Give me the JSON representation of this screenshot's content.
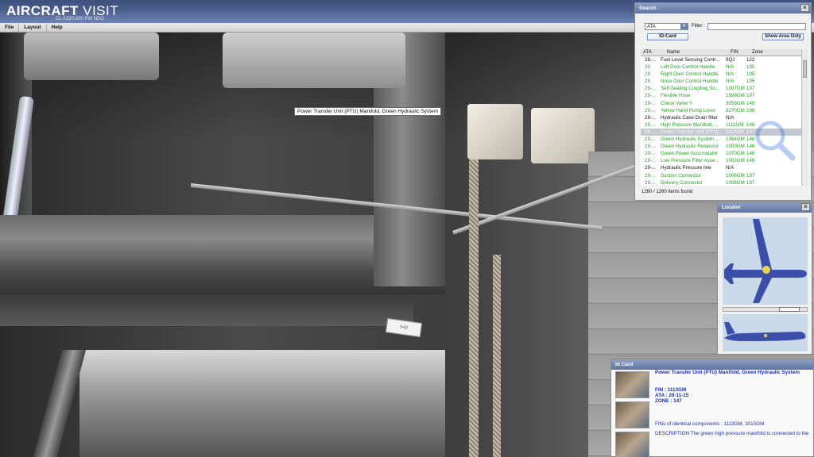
{
  "app": {
    "brand_bold": "AIRCRAFT",
    "brand_light": " VISIT",
    "subtitle": "CL A320-200 PW NEO"
  },
  "menu": [
    "File",
    "Layout",
    "Help"
  ],
  "tooltip": "Power Transfer Unit (PTU) Manifold, Green Hydraulic System",
  "tag_label": "3-02",
  "search": {
    "title": "Search",
    "category": "ATA",
    "filter_label": "Filter :",
    "filter_value": "",
    "id_card_button": "ID-Card",
    "show_area_button": "Show Area Only",
    "columns": [
      "ATA",
      "Name",
      "FIN",
      "Zone"
    ],
    "rows": [
      {
        "ata": "28-...",
        "name": "Fuel Level Sensing Contr...",
        "fin": "9QJ",
        "zone": "122",
        "style": "black"
      },
      {
        "ata": "29",
        "name": "Left Door Control Handle",
        "fin": "N/A",
        "zone": "195",
        "style": "green"
      },
      {
        "ata": "29",
        "name": "Right Door Control Handle",
        "fin": "N/A",
        "zone": "195",
        "style": "green"
      },
      {
        "ata": "29",
        "name": "Nose Door Control Handle",
        "fin": "N/A",
        "zone": "195",
        "style": "green"
      },
      {
        "ata": "29-...",
        "name": "Self-Sealing Coupling So...",
        "fin": "1007GM",
        "zone": "197",
        "style": "green"
      },
      {
        "ata": "29-...",
        "name": "Flexible Hose",
        "fin": "1699GM",
        "zone": "197",
        "style": "green"
      },
      {
        "ata": "29-...",
        "name": "Check Valve Y",
        "fin": "3058GM",
        "zone": "148",
        "style": "green"
      },
      {
        "ata": "29-...",
        "name": "Yellow Hand Pump Lever",
        "fin": "3270GM",
        "zone": "198",
        "style": "green"
      },
      {
        "ata": "29-...",
        "name": "Hydraulic Case Drain filter",
        "fin": "N/A",
        "zone": "",
        "style": "black"
      },
      {
        "ata": "29-...",
        "name": "High Pressure Manifold, ...",
        "fin": "1111GM",
        "zone": "146",
        "style": "green"
      },
      {
        "ata": "29-...",
        "name": "Power Transfer Unit (PTU)...",
        "fin": "1113GM",
        "zone": "147",
        "style": "sel"
      },
      {
        "ata": "29-...",
        "name": "Green Hydraulic System ...",
        "fin": "1064GM",
        "zone": "146",
        "style": "green"
      },
      {
        "ata": "29-...",
        "name": "Green Hydraulic Reservoir",
        "fin": "1000GM",
        "zone": "146",
        "style": "green"
      },
      {
        "ata": "29-...",
        "name": "Green Power Accumulator",
        "fin": "1070GM",
        "zone": "146",
        "style": "green"
      },
      {
        "ata": "29-...",
        "name": "Low Pressure Filter Asse...",
        "fin": "1002GM",
        "zone": "146",
        "style": "green"
      },
      {
        "ata": "29-...",
        "name": "Hydraulic Pressure line",
        "fin": "N/A",
        "zone": "",
        "style": "black"
      },
      {
        "ata": "29-...",
        "name": "Suction Connector",
        "fin": "1006GM",
        "zone": "197",
        "style": "green"
      },
      {
        "ata": "29-...",
        "name": "Delivery Connector",
        "fin": "1008GM",
        "zone": "197",
        "style": "green"
      }
    ],
    "count": "1260 / 1260 items found"
  },
  "locator": {
    "title": "Locator"
  },
  "id_card": {
    "title": "Id Card",
    "name": "Power Transfer Unit (PTU) Manifold, Green Hydraulic System",
    "fin": "FIN : 1113GM",
    "ata": "ATA : 29-11-15",
    "zone": "ZONE : 147",
    "identical": "FINs of identical components : 1113GM, 3015GM",
    "description": "DESCRIPTION The green high pressure manifold is connected to the"
  },
  "colors": {
    "green_text": "#22a022",
    "id_blue": "#1d2fb4",
    "title_bar": "#4a5d8c"
  }
}
